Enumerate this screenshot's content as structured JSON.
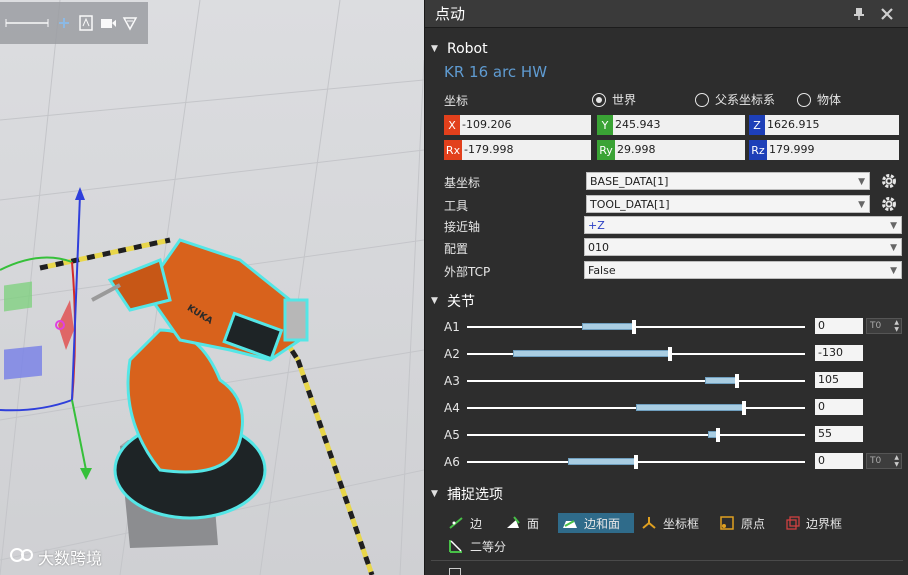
{
  "viewport": {
    "toolbar_icons": [
      "ruler-icon",
      "plus-icon",
      "pdf-icon",
      "video-icon",
      "render-icon"
    ],
    "watermark_text": "大数跨境",
    "robot_brand": "KUKA"
  },
  "panel": {
    "title": "点动",
    "pin_icon": "pin-icon",
    "close_icon": "close-icon",
    "robot_section": {
      "heading": "Robot",
      "model": "KR 16 arc HW",
      "coord_label": "坐标",
      "coord_options": [
        {
          "label": "世界",
          "selected": true
        },
        {
          "label": "父系坐标系",
          "selected": false
        },
        {
          "label": "物体",
          "selected": false
        }
      ],
      "positions": [
        {
          "tag": "X",
          "value": "-109.206",
          "color": "#e2401c"
        },
        {
          "tag": "Y",
          "value": "245.943",
          "color": "#3aa335"
        },
        {
          "tag": "Z",
          "value": "1626.915",
          "color": "#1d3fb8"
        }
      ],
      "rotations": [
        {
          "tag": "Rx",
          "value": "-179.998",
          "color": "#e2401c"
        },
        {
          "tag": "Ry",
          "value": "29.998",
          "color": "#3aa335"
        },
        {
          "tag": "Rz",
          "value": "179.999",
          "color": "#1d3fb8"
        }
      ],
      "base_label": "基坐标",
      "base_value": "BASE_DATA[1]",
      "tool_label": "工具",
      "tool_value": "TOOL_DATA[1]",
      "approach_label": "接近轴",
      "approach_value": "+Z",
      "config_label": "配置",
      "config_value": "010",
      "external_tcp_label": "外部TCP",
      "external_tcp_value": "False"
    },
    "joints_section": {
      "heading": "关节",
      "joints": [
        {
          "name": "A1",
          "value": "0",
          "fill_from": 0.34,
          "fill_to": 0.495,
          "has_spin": true,
          "spin_label": "T0"
        },
        {
          "name": "A2",
          "value": "-130",
          "fill_from": 0.137,
          "fill_to": 0.6,
          "has_spin": false,
          "spin_label": ""
        },
        {
          "name": "A3",
          "value": "105",
          "fill_from": 0.705,
          "fill_to": 0.8,
          "has_spin": false,
          "spin_label": ""
        },
        {
          "name": "A4",
          "value": "0",
          "fill_from": 0.5,
          "fill_to": 0.82,
          "has_spin": false,
          "spin_label": ""
        },
        {
          "name": "A5",
          "value": "55",
          "fill_from": 0.712,
          "fill_to": 0.742,
          "has_spin": false,
          "spin_label": ""
        },
        {
          "name": "A6",
          "value": "0",
          "fill_from": 0.3,
          "fill_to": 0.5,
          "has_spin": true,
          "spin_label": "T0"
        }
      ]
    },
    "snap_section": {
      "heading": "捕捉选项",
      "items": [
        {
          "label": "边",
          "icon": "edge-icon",
          "active": false
        },
        {
          "label": "面",
          "icon": "face-icon",
          "active": false
        },
        {
          "label": "边和面",
          "icon": "edge-face-icon",
          "active": true
        },
        {
          "label": "坐标框",
          "icon": "frame-icon",
          "active": false
        },
        {
          "label": "原点",
          "icon": "origin-icon",
          "active": false
        },
        {
          "label": "边界框",
          "icon": "bounding-box-icon",
          "active": false
        },
        {
          "label": "二等分",
          "icon": "bisect-icon",
          "active": false
        }
      ]
    },
    "colors": {
      "accent": "#5f9bd1",
      "active_snap": "#2f6b8a"
    }
  }
}
